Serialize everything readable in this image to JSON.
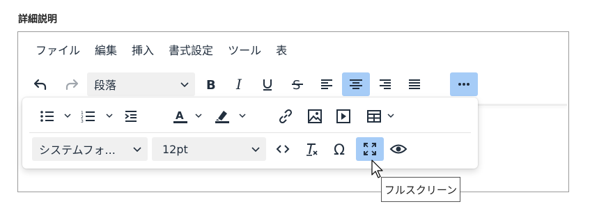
{
  "field": {
    "label": "詳細説明"
  },
  "menubar": {
    "items": [
      "ファイル",
      "編集",
      "挿入",
      "書式設定",
      "ツール",
      "表"
    ]
  },
  "toolbar": {
    "block_format": "段落",
    "font_family": "システムフォ...",
    "font_size": "12pt",
    "active": [
      "align-center",
      "more",
      "fullscreen"
    ],
    "icons": [
      "undo-icon",
      "redo-icon",
      "bold-icon",
      "italic-icon",
      "underline-icon",
      "strikethrough-icon",
      "align-left-icon",
      "align-center-icon",
      "align-right-icon",
      "justify-icon",
      "more-icon",
      "bullet-list-icon",
      "numbered-list-icon",
      "outdent-icon",
      "text-color-icon",
      "highlight-icon",
      "link-icon",
      "image-icon",
      "media-icon",
      "table-icon",
      "code-icon",
      "clear-format-icon",
      "omega-icon",
      "fullscreen-icon",
      "preview-icon"
    ]
  },
  "tooltip": {
    "text": "フルスクリーン"
  },
  "colors": {
    "accent": "#a6ccf7",
    "icon": "#222f3e",
    "border": "#9a9a9a"
  }
}
